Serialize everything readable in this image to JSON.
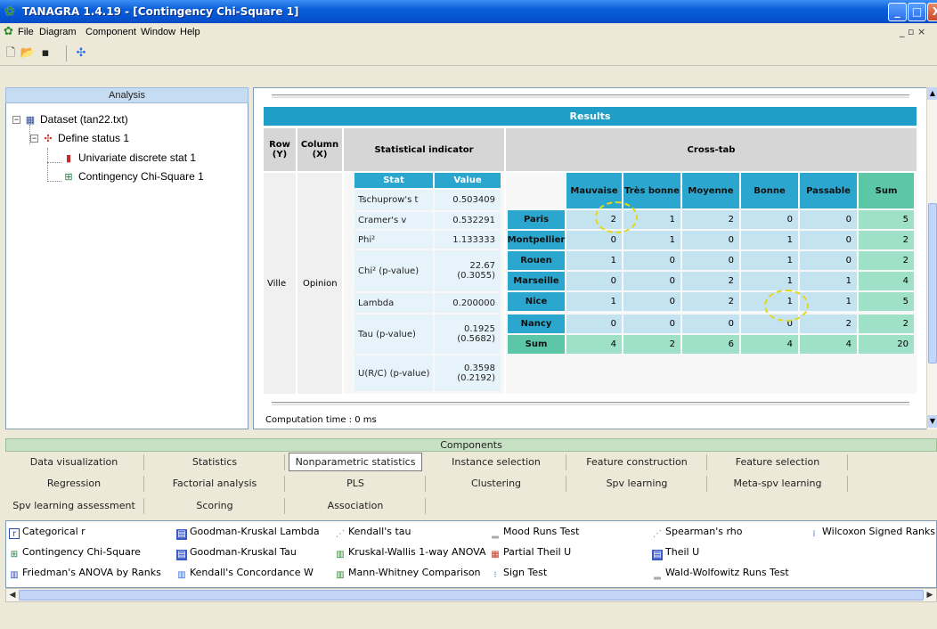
{
  "window": {
    "title": "TANAGRA 1.4.19 - [Contingency Chi-Square 1]",
    "min_glyph": "_",
    "max_glyph": "□",
    "close_glyph": "X",
    "mdi_controls": "_ ▫ ×"
  },
  "menu": {
    "items": [
      "File",
      "Diagram",
      "Component",
      "Window",
      "Help"
    ]
  },
  "toolbar": {
    "icons": [
      "new-file-icon",
      "open-folder-icon",
      "save-disk-icon",
      "diagram-icon"
    ]
  },
  "analysis": {
    "header": "Analysis",
    "tree": {
      "dataset": "Dataset (tan22.txt)",
      "define_status": "Define status 1",
      "univariate": "Univariate discrete stat 1",
      "contingency": "Contingency Chi-Square 1"
    }
  },
  "results": {
    "title": "Results",
    "headers": {
      "row": "Row\n(Y)",
      "column": "Column\n(X)",
      "stat_indicator": "Statistical indicator",
      "crosstab": "Cross-tab"
    },
    "row_var": "Ville",
    "col_var": "Opinion",
    "stat_col_headers": [
      "Stat",
      "Value"
    ],
    "stats": [
      {
        "name": "Tschuprow's t",
        "value": "0.503409"
      },
      {
        "name": "Cramer's v",
        "value": "0.532291"
      },
      {
        "name": "Phi²",
        "value": "1.133333"
      },
      {
        "name": "Chi² (p-value)",
        "value": "22.67\n(0.3055)"
      },
      {
        "name": "Lambda",
        "value": "0.200000"
      },
      {
        "name": "Tau (p-value)",
        "value": "0.1925\n(0.5682)"
      },
      {
        "name": "U(R/C) (p-value)",
        "value": "0.3598\n(0.2192)"
      }
    ],
    "crosstab_cols": [
      "Mauvaise",
      "Très bonne",
      "Moyenne",
      "Bonne",
      "Passable",
      "Sum"
    ],
    "crosstab_rows": [
      {
        "label": "Paris",
        "values": [
          "2",
          "1",
          "2",
          "0",
          "0",
          "5"
        ]
      },
      {
        "label": "Montpellier",
        "values": [
          "0",
          "1",
          "0",
          "1",
          "0",
          "2"
        ]
      },
      {
        "label": "Rouen",
        "values": [
          "1",
          "0",
          "0",
          "1",
          "0",
          "2"
        ]
      },
      {
        "label": "Marseille",
        "values": [
          "0",
          "0",
          "2",
          "1",
          "1",
          "4"
        ]
      },
      {
        "label": "Nice",
        "values": [
          "1",
          "0",
          "2",
          "1",
          "1",
          "5"
        ]
      },
      {
        "label": "Nancy",
        "values": [
          "0",
          "0",
          "0",
          "0",
          "2",
          "2"
        ]
      },
      {
        "label": "Sum",
        "values": [
          "4",
          "2",
          "6",
          "4",
          "4",
          "20"
        ]
      }
    ],
    "computation_time": "Computation time : 0 ms"
  },
  "components": {
    "header": "Components",
    "tabs_row1": [
      "Data visualization",
      "Statistics",
      "Nonparametric statistics",
      "Instance selection",
      "Feature construction",
      "Feature selection"
    ],
    "tabs_row2": [
      "Regression",
      "Factorial analysis",
      "PLS",
      "Clustering",
      "Spv learning",
      "Meta-spv learning"
    ],
    "tabs_row3": [
      "Spv learning assessment",
      "Scoring",
      "Association"
    ],
    "active_tab": "Nonparametric statistics",
    "items": [
      [
        "Categorical r",
        "Goodman-Kruskal Lambda",
        "Kendall's tau",
        "Mood Runs Test",
        "Spearman's rho",
        "Wilcoxon Signed Ranks"
      ],
      [
        "Contingency Chi-Square",
        "Goodman-Kruskal Tau",
        "Kruskal-Wallis 1-way ANOVA",
        "Partial Theil U",
        "Theil U"
      ],
      [
        "Friedman's ANOVA by Ranks",
        "Kendall's Concordance W",
        "Mann-Whitney Comparison",
        "Sign Test",
        "Wald-Wolfowitz Runs Test"
      ]
    ]
  },
  "colors": {
    "title_bar": "#0552d0",
    "results_bar": "#1e9ec8",
    "crosstab_header": "#2ba7cf",
    "sum_header": "#5cc7a6",
    "highlight_circle": "#e6d61c"
  }
}
